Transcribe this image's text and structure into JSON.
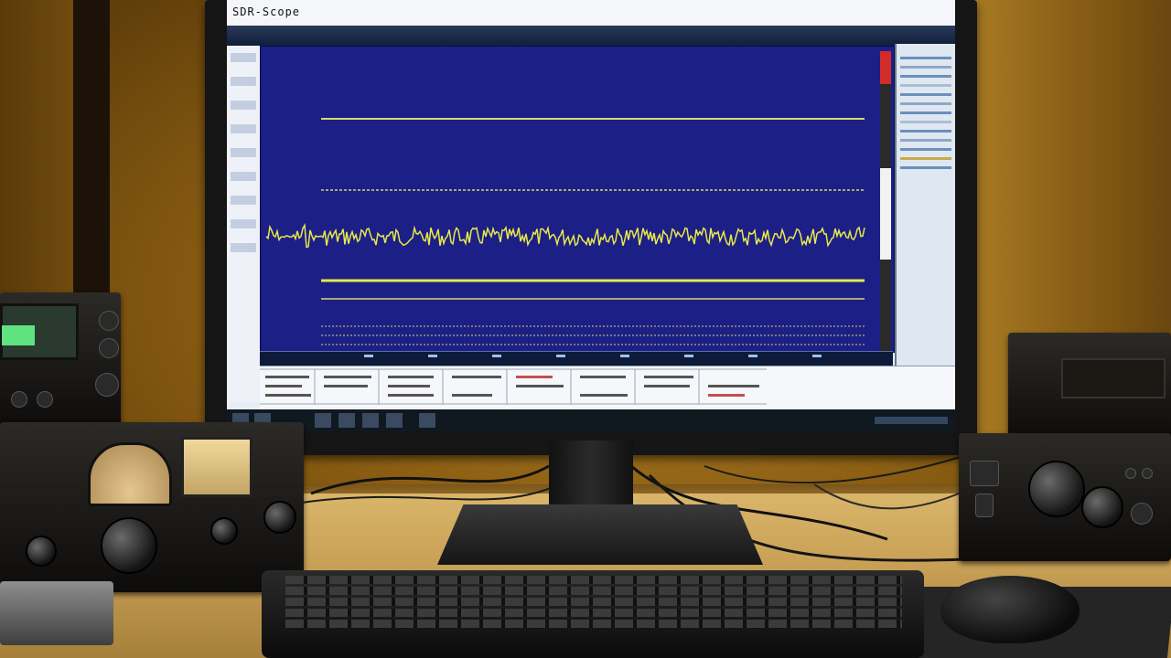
{
  "scene": "desk-with-monitor-and-radios",
  "screen": {
    "app_title": "SDR-Scope",
    "toolbar_labels": [
      "",
      "",
      "",
      ""
    ],
    "waveform_color": "#e8e84a",
    "plot_background": "#1c1f86"
  },
  "colors": {
    "wall": "#a97b24",
    "desk": "#caa257",
    "meter_face": "#e6c690",
    "radio_led": "#5fe27f"
  }
}
